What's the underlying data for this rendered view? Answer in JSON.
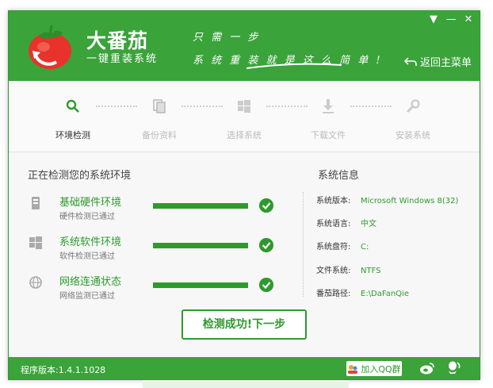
{
  "app": {
    "brand_title": "大番茄",
    "brand_subtitle": "一键重装系统",
    "slogan_line1": "只 需 一 步",
    "slogan_line2": "系 统 重 装 就 是 这 么 简 单 !",
    "back_label": "返回主菜单"
  },
  "window_controls": {
    "menu": "▼",
    "minimize": "—",
    "close": "✕"
  },
  "steps": [
    {
      "label": "环境检测",
      "icon": "search-icon",
      "active": true
    },
    {
      "label": "备份资料",
      "icon": "backup-icon",
      "active": false
    },
    {
      "label": "选择系统",
      "icon": "windows-icon",
      "active": false
    },
    {
      "label": "下载文件",
      "icon": "download-icon",
      "active": false
    },
    {
      "label": "安装系统",
      "icon": "wrench-icon",
      "active": false
    }
  ],
  "checks": {
    "title": "正在检测您的系统环境",
    "items": [
      {
        "title": "基础硬件环境",
        "sub": "硬件检测已通过",
        "icon": "hardware-icon",
        "progress": 1.0
      },
      {
        "title": "系统软件环境",
        "sub": "软件检测已通过",
        "icon": "windows-icon",
        "progress": 1.0
      },
      {
        "title": "网络连通状态",
        "sub": "网络监测已通过",
        "icon": "globe-icon",
        "progress": 1.0
      }
    ]
  },
  "sysinfo": {
    "title": "系统信息",
    "rows": [
      {
        "label": "系统版本:",
        "value": "Microsoft Windows 8(32)"
      },
      {
        "label": "系统语言:",
        "value": "中文"
      },
      {
        "label": "系统盘符:",
        "value": "C:"
      },
      {
        "label": "文件系统:",
        "value": "NTFS"
      },
      {
        "label": "番茄路径:",
        "value": "E:\\DaFanQie"
      }
    ]
  },
  "next_button": "检测成功!下一步",
  "footer": {
    "version": "程序版本:1.4.1.1028",
    "qq_group": "加入QQ群"
  },
  "colors": {
    "accent": "#3aa33a",
    "accent_dark": "#2e9a2e"
  }
}
